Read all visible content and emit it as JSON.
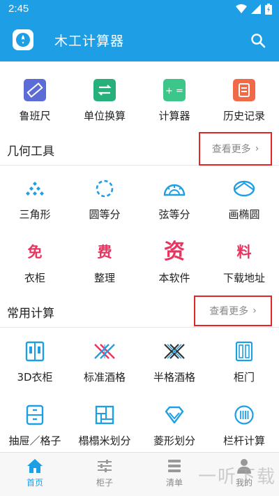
{
  "status_bar": {
    "time": "2:45"
  },
  "app_bar": {
    "title": "木工计算器"
  },
  "quick_tools": [
    {
      "label": "鲁班尺",
      "icon": "ruler-icon",
      "color": "#5b6cd6"
    },
    {
      "label": "单位换算",
      "icon": "convert-icon",
      "color": "#26b07a"
    },
    {
      "label": "计算器",
      "icon": "calculator-icon",
      "color": "#3cc68a"
    },
    {
      "label": "历史记录",
      "icon": "history-icon",
      "color": "#f06a4a"
    }
  ],
  "geometry_section": {
    "title": "几何工具",
    "more": "查看更多",
    "items": [
      {
        "label": "三角形",
        "icon": "triangle-icon"
      },
      {
        "label": "圆等分",
        "icon": "circle-divide-icon"
      },
      {
        "label": "弦等分",
        "icon": "chord-divide-icon"
      },
      {
        "label": "画椭圆",
        "icon": "ellipse-icon"
      }
    ],
    "ad_items": [
      {
        "badge": "免",
        "label": "衣柜"
      },
      {
        "badge": "费",
        "label": "整理"
      },
      {
        "badge": "资",
        "label": "本软件"
      },
      {
        "badge": "料",
        "label": "下载地址"
      }
    ]
  },
  "common_section": {
    "title": "常用计算",
    "more": "查看更多",
    "items_row1": [
      {
        "label": "3D衣柜",
        "icon": "wardrobe-3d-icon"
      },
      {
        "label": "标准酒格",
        "icon": "wine-rack-icon"
      },
      {
        "label": "半格酒格",
        "icon": "half-wine-rack-icon"
      },
      {
        "label": "柜门",
        "icon": "cabinet-door-icon"
      }
    ],
    "items_row2": [
      {
        "label": "抽屉／格子",
        "icon": "drawer-icon"
      },
      {
        "label": "榻榻米划分",
        "icon": "tatami-icon"
      },
      {
        "label": "菱形划分",
        "icon": "diamond-icon"
      },
      {
        "label": "栏杆计算",
        "icon": "railing-icon"
      }
    ]
  },
  "bottom_nav": [
    {
      "label": "首页",
      "icon": "home-icon",
      "active": true
    },
    {
      "label": "柜子",
      "icon": "sliders-icon",
      "active": false
    },
    {
      "label": "清单",
      "icon": "list-icon",
      "active": false
    },
    {
      "label": "我的",
      "icon": "user-icon",
      "active": false
    }
  ],
  "watermark": "一听下载",
  "colors": {
    "primary": "#1e9fe5",
    "accent_red": "#e8345e",
    "highlight_box": "#e02626"
  }
}
